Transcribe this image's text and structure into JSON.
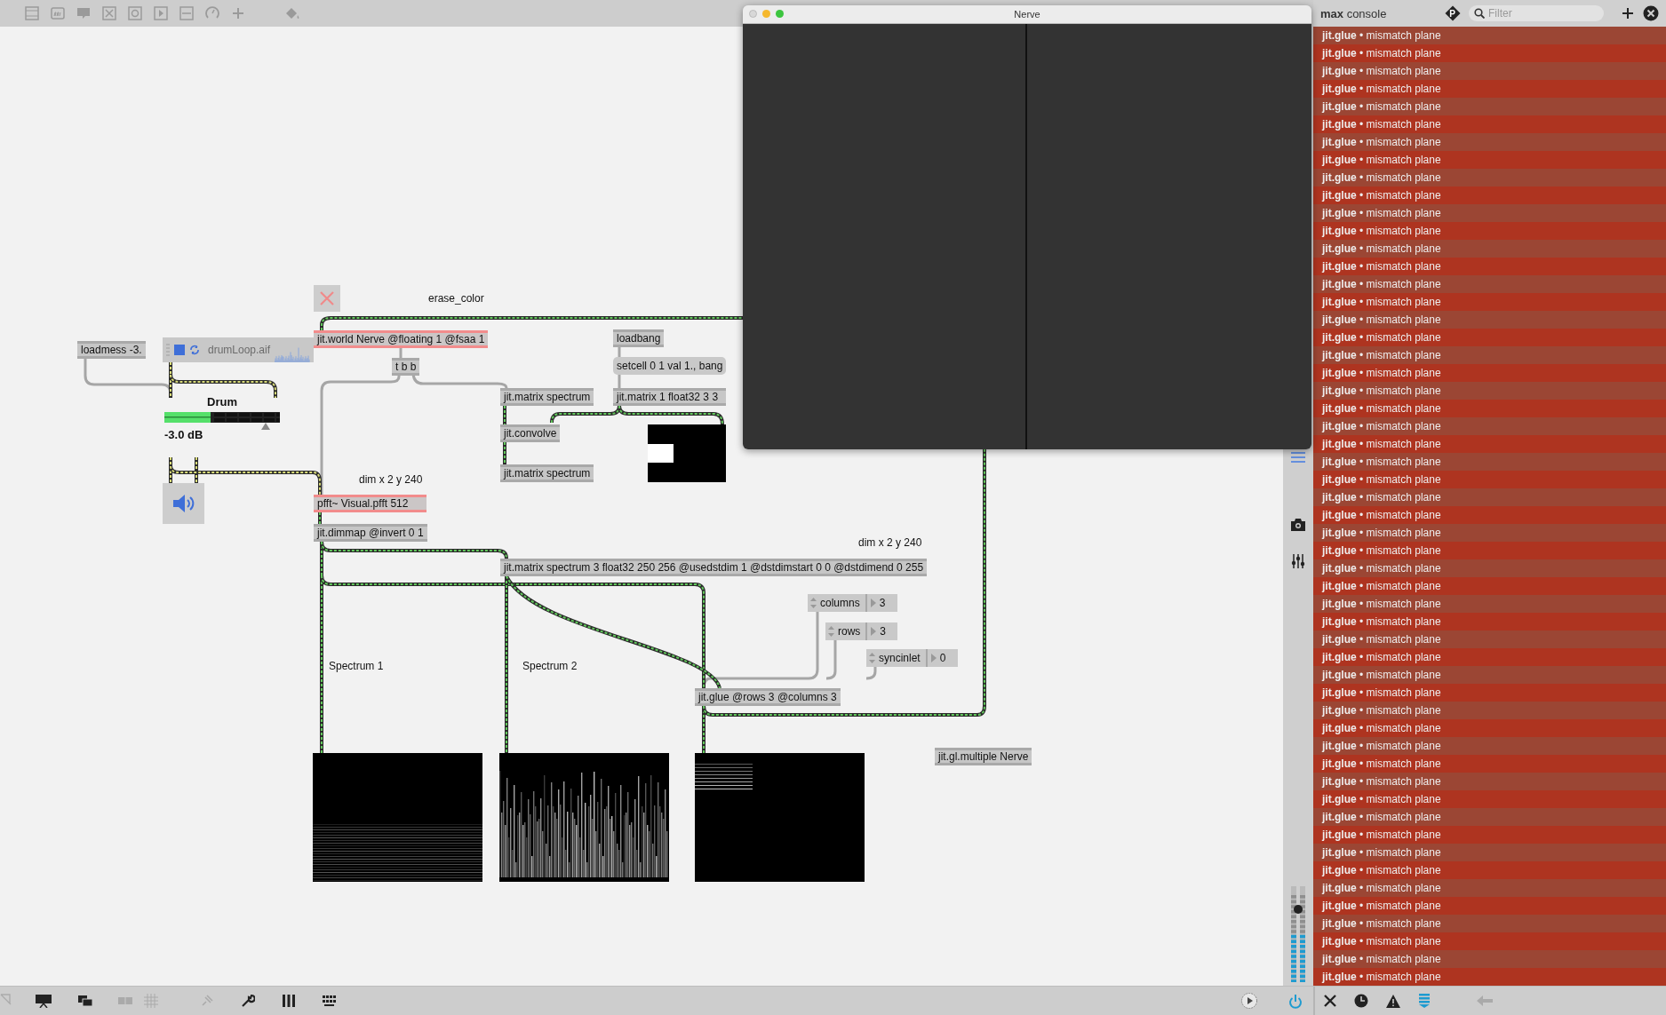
{
  "patcher": {
    "objects": [
      {
        "kind": "button"
      },
      {
        "kind": "comment",
        "text": "erase_color"
      },
      {
        "kind": "object",
        "text": "jit.world Nerve @floating 1 @fsaa 1",
        "highlighted": true
      },
      {
        "kind": "object",
        "text": "loadmess -3.",
        "highlighted": false
      },
      {
        "kind": "playlist",
        "file": "drumLoop.aif"
      },
      {
        "kind": "object",
        "text": "t b b",
        "highlighted": false
      },
      {
        "kind": "object",
        "text": "loadbang",
        "highlighted": false
      },
      {
        "kind": "message",
        "text": "setcell 0 1 val 1., bang"
      },
      {
        "kind": "object",
        "text": "jit.matrix spectrum",
        "highlighted": false
      },
      {
        "kind": "object",
        "text": "jit.matrix 1 float32 3 3",
        "highlighted": false
      },
      {
        "kind": "gain",
        "label": "Drum",
        "level": 0.88,
        "reading": "-3.0 dB"
      },
      {
        "kind": "object",
        "text": "jit.convolve",
        "highlighted": false
      },
      {
        "kind": "matrix_view"
      },
      {
        "kind": "object",
        "text": "jit.matrix spectrum",
        "highlighted": false
      },
      {
        "kind": "comment",
        "text": "dim x 2 y 240"
      },
      {
        "kind": "ezdac"
      },
      {
        "kind": "object",
        "text": "pfft~ Visual.pfft 512",
        "highlighted": true
      },
      {
        "kind": "object",
        "text": "jit.dimmap @invert 0 1",
        "highlighted": false
      },
      {
        "kind": "comment",
        "text": "dim x 2 y 240"
      },
      {
        "kind": "object",
        "text": "jit.matrix spectrum 3 float32 250 256 @usedstdim 1 @dstdimstart 0 0 @dstdimend 0 255",
        "highlighted": false
      },
      {
        "kind": "attrui",
        "label": "columns",
        "value": "3"
      },
      {
        "kind": "attrui",
        "label": "rows",
        "value": "3"
      },
      {
        "kind": "attrui",
        "label": "syncinlet",
        "value": "0"
      },
      {
        "kind": "comment",
        "text": "Spectrum 1"
      },
      {
        "kind": "comment",
        "text": "Spectrum 2"
      },
      {
        "kind": "object",
        "text": "jit.glue @rows 3 @columns 3",
        "highlighted": false
      },
      {
        "kind": "object",
        "text": "jit.gl.multiple Nerve",
        "highlighted": false
      },
      {
        "kind": "spectrum_display"
      },
      {
        "kind": "spectrum_display"
      },
      {
        "kind": "spectrum_display"
      }
    ]
  },
  "nerve_window": {
    "title": "Nerve"
  },
  "console": {
    "title": "**max** console",
    "p_button": "P",
    "filter": {
      "placeholder": "Filter"
    },
    "messages": [
      {
        "text": "**jit.glue** • mismatch plane"
      },
      {
        "text": "**jit.glue** • mismatch plane"
      },
      {
        "text": "**jit.glue** • mismatch plane"
      },
      {
        "text": "**jit.glue** • mismatch plane"
      },
      {
        "text": "**jit.glue** • mismatch plane"
      },
      {
        "text": "**jit.glue** • mismatch plane"
      },
      {
        "text": "**jit.glue** • mismatch plane"
      },
      {
        "text": "**jit.glue** • mismatch plane"
      },
      {
        "text": "**jit.glue** • mismatch plane"
      },
      {
        "text": "**jit.glue** • mismatch plane"
      },
      {
        "text": "**jit.glue** • mismatch plane"
      },
      {
        "text": "**jit.glue** • mismatch plane"
      },
      {
        "text": "**jit.glue** • mismatch plane"
      },
      {
        "text": "**jit.glue** • mismatch plane"
      },
      {
        "text": "**jit.glue** • mismatch plane"
      },
      {
        "text": "**jit.glue** • mismatch plane"
      },
      {
        "text": "**jit.glue** • mismatch plane"
      },
      {
        "text": "**jit.glue** • mismatch plane"
      },
      {
        "text": "**jit.glue** • mismatch plane"
      },
      {
        "text": "**jit.glue** • mismatch plane"
      },
      {
        "text": "**jit.glue** • mismatch plane"
      },
      {
        "text": "**jit.glue** • mismatch plane"
      },
      {
        "text": "**jit.glue** • mismatch plane"
      },
      {
        "text": "**jit.glue** • mismatch plane"
      },
      {
        "text": "**jit.glue** • mismatch plane"
      },
      {
        "text": "**jit.glue** • mismatch plane"
      },
      {
        "text": "**jit.glue** • mismatch plane"
      },
      {
        "text": "**jit.glue** • mismatch plane"
      },
      {
        "text": "**jit.glue** • mismatch plane"
      },
      {
        "text": "**jit.glue** • mismatch plane"
      },
      {
        "text": "**jit.glue** • mismatch plane"
      },
      {
        "text": "**jit.glue** • mismatch plane"
      },
      {
        "text": "**jit.glue** • mismatch plane"
      },
      {
        "text": "**jit.glue** • mismatch plane"
      },
      {
        "text": "**jit.glue** • mismatch plane"
      },
      {
        "text": "**jit.glue** • mismatch plane"
      },
      {
        "text": "**jit.glue** • mismatch plane"
      },
      {
        "text": "**jit.glue** • mismatch plane"
      },
      {
        "text": "**jit.glue** • mismatch plane"
      },
      {
        "text": "**jit.glue** • mismatch plane"
      },
      {
        "text": "**jit.glue** • mismatch plane"
      },
      {
        "text": "**jit.glue** • mismatch plane"
      },
      {
        "text": "**jit.glue** • mismatch plane"
      },
      {
        "text": "**jit.glue** • mismatch plane"
      },
      {
        "text": "**jit.glue** • mismatch plane"
      },
      {
        "text": "**jit.glue** • mismatch plane"
      },
      {
        "text": "**jit.glue** • mismatch plane"
      },
      {
        "text": "**jit.glue** • mismatch plane"
      },
      {
        "text": "**jit.glue** • mismatch plane"
      },
      {
        "text": "**jit.glue** • mismatch plane"
      },
      {
        "text": "**jit.glue** • mismatch plane"
      },
      {
        "text": "**jit.glue** • mismatch plane"
      },
      {
        "text": "**jit.glue** • mismatch plane"
      },
      {
        "text": "**jit.glue** • mismatch plane"
      }
    ]
  }
}
